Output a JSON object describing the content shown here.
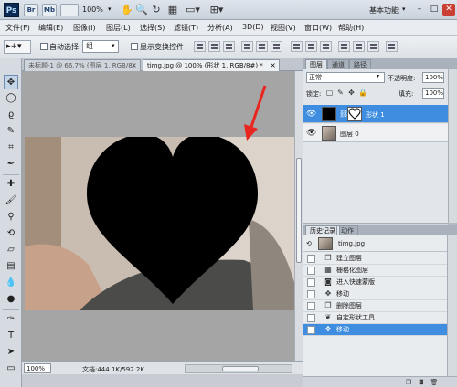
{
  "app": {
    "logo": "Ps",
    "bridge": "Br",
    "minibridge": "Mb",
    "zoom": "100%",
    "workspace": "基本功能"
  },
  "menu": [
    "文件(F)",
    "编辑(E)",
    "图像(I)",
    "图层(L)",
    "选择(S)",
    "滤镜(T)",
    "分析(A)",
    "3D(D)",
    "视图(V)",
    "窗口(W)",
    "帮助(H)"
  ],
  "options": {
    "auto_select_label": "自动选择:",
    "auto_select_value": "组",
    "show_transform_label": "显示变换控件"
  },
  "document": {
    "tab1": "未标题-1 @ 66.7% (图层 1, RGB/8)",
    "tab2": "timg.jpg @ 100% (形状 1, RGB/8#) *",
    "status_zoom": "100%",
    "status_doc": "文档:444.1K/592.2K"
  },
  "layers_panel": {
    "tabs": [
      "图层",
      "通道",
      "路径"
    ],
    "blend_mode": "正常",
    "opacity_label": "不透明度:",
    "opacity_value": "100%",
    "lock_label": "锁定:",
    "fill_label": "填充:",
    "fill_value": "100%",
    "layers": [
      {
        "name": "形状 1",
        "selected": true
      },
      {
        "name": "图层 0",
        "selected": false
      }
    ]
  },
  "history_panel": {
    "tabs": [
      "历史记录",
      "动作"
    ],
    "snapshot": "timg.jpg",
    "steps": [
      "建立图层",
      "栅格化图层",
      "进入快速蒙版",
      "移动",
      "删除图层",
      "自定形状工具",
      "移动"
    ]
  },
  "colors": {
    "selection": "#3f8de0",
    "annotation_arrow": "#e8261f",
    "heart_fill": "#000000"
  }
}
